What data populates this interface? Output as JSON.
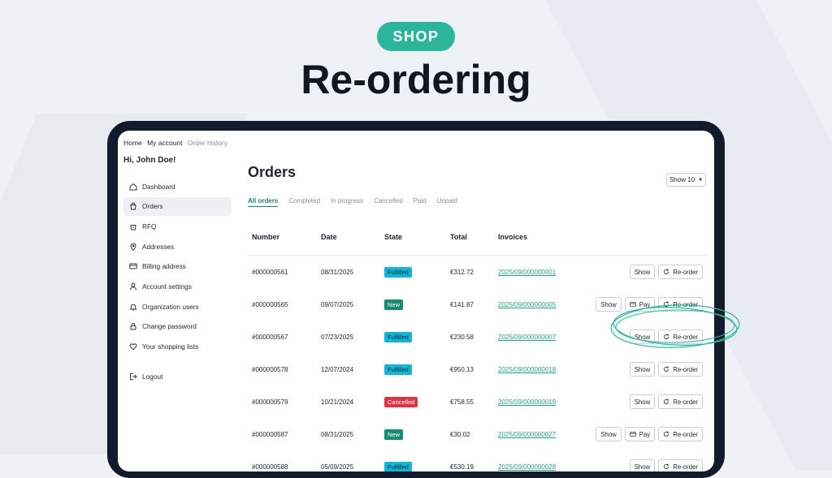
{
  "banner": {
    "badge": "SHOP",
    "headline": "Re-ordering"
  },
  "breadcrumbs": [
    "Home",
    "My account",
    "Order history"
  ],
  "greeting": "Hi, John Doe!",
  "sidebar": {
    "items": [
      {
        "label": "Dashboard",
        "icon": "home-icon"
      },
      {
        "label": "Orders",
        "icon": "bag-icon",
        "active": true
      },
      {
        "label": "RFQ",
        "icon": "bag-question-icon"
      },
      {
        "label": "Addresses",
        "icon": "location-pin-icon"
      },
      {
        "label": "Billing address",
        "icon": "credit-card-icon"
      },
      {
        "label": "Account settings",
        "icon": "person-icon"
      },
      {
        "label": "Organization users",
        "icon": "bell-icon"
      },
      {
        "label": "Change password",
        "icon": "lock-icon"
      },
      {
        "label": "Your shopping lists",
        "icon": "heart-icon"
      }
    ],
    "logout": {
      "label": "Logout",
      "icon": "logout-icon"
    }
  },
  "page": {
    "title": "Orders",
    "show_select": "Show 10",
    "tabs": [
      "All orders",
      "Completed",
      "In progress",
      "Cancelled",
      "Paid",
      "Unpaid"
    ],
    "active_tab": "All orders"
  },
  "table": {
    "columns": [
      "Number",
      "Date",
      "State",
      "Total",
      "Invoices"
    ],
    "buttons": {
      "show": "Show",
      "pay": "Pay",
      "reorder": "Re-order"
    },
    "rows": [
      {
        "number": "#000000561",
        "date": "08/31/2025",
        "state": "Fulfilled",
        "total": "€312.72",
        "invoice": "2025/09/000000001",
        "pay": false
      },
      {
        "number": "#000000565",
        "date": "09/07/2025",
        "state": "New",
        "total": "€141.87",
        "invoice": "2025/09/000000005",
        "pay": true
      },
      {
        "number": "#000000567",
        "date": "07/23/2025",
        "state": "Fulfilled",
        "total": "€230.58",
        "invoice": "2025/09/000000007",
        "pay": false
      },
      {
        "number": "#000000578",
        "date": "12/07/2024",
        "state": "Fulfilled",
        "total": "€950.13",
        "invoice": "2025/09/000000018",
        "pay": false
      },
      {
        "number": "#000000579",
        "date": "10/21/2024",
        "state": "Cancelled",
        "total": "€758.55",
        "invoice": "2025/09/000000019",
        "pay": false
      },
      {
        "number": "#000000587",
        "date": "08/31/2025",
        "state": "New",
        "total": "€30.02",
        "invoice": "2025/09/000000027",
        "pay": true
      },
      {
        "number": "#000000588",
        "date": "05/09/2025",
        "state": "Fulfilled",
        "total": "€530.19",
        "invoice": "2025/09/000000028",
        "pay": false
      }
    ]
  },
  "colors": {
    "accent": "#2bb59a",
    "link": "#2a9f86",
    "fulfilled": "#14b4d6",
    "new": "#178b74",
    "cancelled": "#dc3545",
    "device": "#131a2b"
  }
}
